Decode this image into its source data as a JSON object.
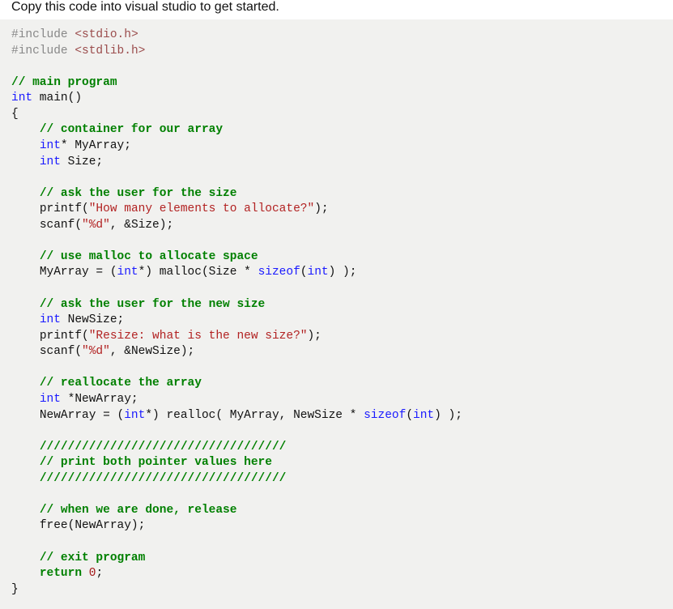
{
  "heading": "Copy this code into visual studio to get started.",
  "code": {
    "include1_directive": "#include ",
    "include1_target": "<stdio.h>",
    "include2_directive": "#include ",
    "include2_target": "<stdlib.h>",
    "cmt_main": "// main program",
    "kw_int": "int",
    "id_main": " main()",
    "brace_open": "{",
    "cmt_container": "// container for our array",
    "decl_myarray_star": "* MyArray;",
    "decl_size": " Size;",
    "cmt_ask_size": "// ask the user for the size",
    "printf1_call": "printf(",
    "printf1_str": "\"How many elements to allocate?\"",
    "printf1_end": ");",
    "scanf1_call": "scanf(",
    "scanf1_str": "\"%d\"",
    "scanf1_rest": ", &Size);",
    "cmt_malloc": "// use malloc to allocate space",
    "malloc_lhs": "MyArray = (",
    "malloc_cast_star": "*) malloc(Size * ",
    "kw_sizeof": "sizeof",
    "malloc_sizeof_arg_open": "(",
    "malloc_sizeof_arg_close": ") );",
    "cmt_ask_newsize": "// ask the user for the new size",
    "decl_newsize": " NewSize;",
    "printf2_call": "printf(",
    "printf2_str": "\"Resize: what is the new size?\"",
    "printf2_end": ");",
    "scanf2_call": "scanf(",
    "scanf2_str": "\"%d\"",
    "scanf2_rest": ", &NewSize);",
    "cmt_realloc": "// reallocate the array",
    "decl_newarray_star": " *NewArray;",
    "realloc_lhs": "NewArray = (",
    "realloc_cast_star": "*) realloc( MyArray, NewSize * ",
    "realloc_sizeof_arg_close": ") );",
    "cmt_bar1": "///////////////////////////////////",
    "cmt_print": "// print both pointer values here",
    "cmt_bar2": "///////////////////////////////////",
    "cmt_release": "// when we are done, release",
    "free_call": "free(NewArray);",
    "cmt_exit": "// exit program",
    "kw_return": "return",
    "return_rest_sp": " ",
    "return_zero": "0",
    "return_semi": ";",
    "brace_close": "}",
    "indent1": "    ",
    "blank": ""
  }
}
